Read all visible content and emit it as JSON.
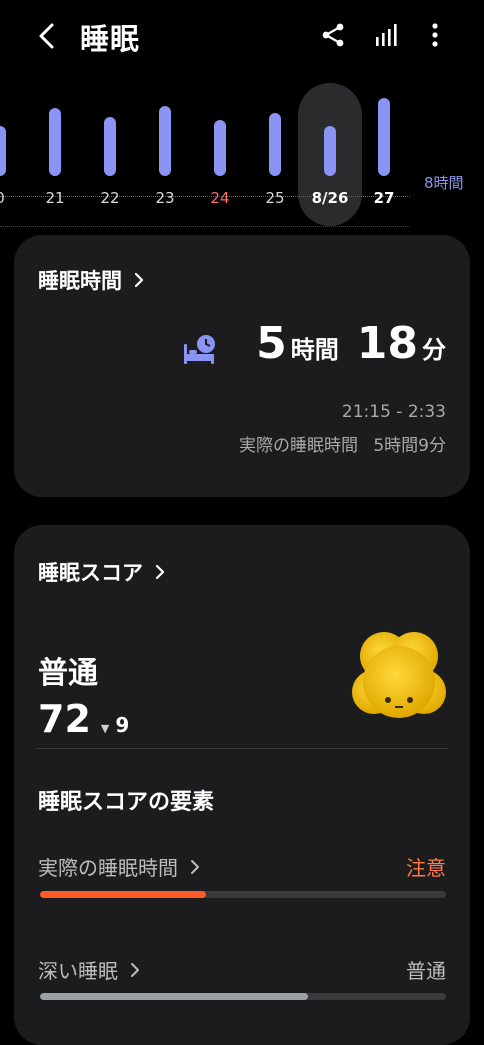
{
  "header": {
    "title": "睡眠"
  },
  "timeline": {
    "days": [
      {
        "label": "0",
        "hours": 5.3,
        "type": "normal"
      },
      {
        "label": "21",
        "hours": 7.2,
        "type": "normal"
      },
      {
        "label": "22",
        "hours": 6.3,
        "type": "normal"
      },
      {
        "label": "23",
        "hours": 7.5,
        "type": "normal"
      },
      {
        "label": "24",
        "hours": 6.0,
        "type": "holiday"
      },
      {
        "label": "25",
        "hours": 6.7,
        "type": "normal"
      },
      {
        "label": "8/26",
        "hours": 5.3,
        "type": "selected"
      },
      {
        "label": "27",
        "hours": 8.3,
        "type": "bold"
      }
    ],
    "goal_label": "8時間",
    "bar_color": "#8b93f5"
  },
  "duration_card": {
    "title": "睡眠時間",
    "hours": "5",
    "hours_unit": "時間",
    "minutes": "18",
    "minutes_unit": "分",
    "time_range": "21:15 - 2:33",
    "actual_label": "実際の睡眠時間",
    "actual_value": "5時間9分"
  },
  "score_card": {
    "title": "睡眠スコア",
    "level": "普通",
    "score": "72",
    "delta_icon": "▼",
    "delta": "9",
    "factors_title": "睡眠スコアの要素",
    "factors": [
      {
        "label": "実際の睡眠時間",
        "status": "注意",
        "status_color": "#ff7a45",
        "bar_color": "#ff5a28",
        "fraction": 0.41
      },
      {
        "label": "深い睡眠",
        "status": "普通",
        "status_color": "#bcbcbc",
        "bar_color": "#9aa0a6",
        "fraction": 0.66
      }
    ]
  }
}
